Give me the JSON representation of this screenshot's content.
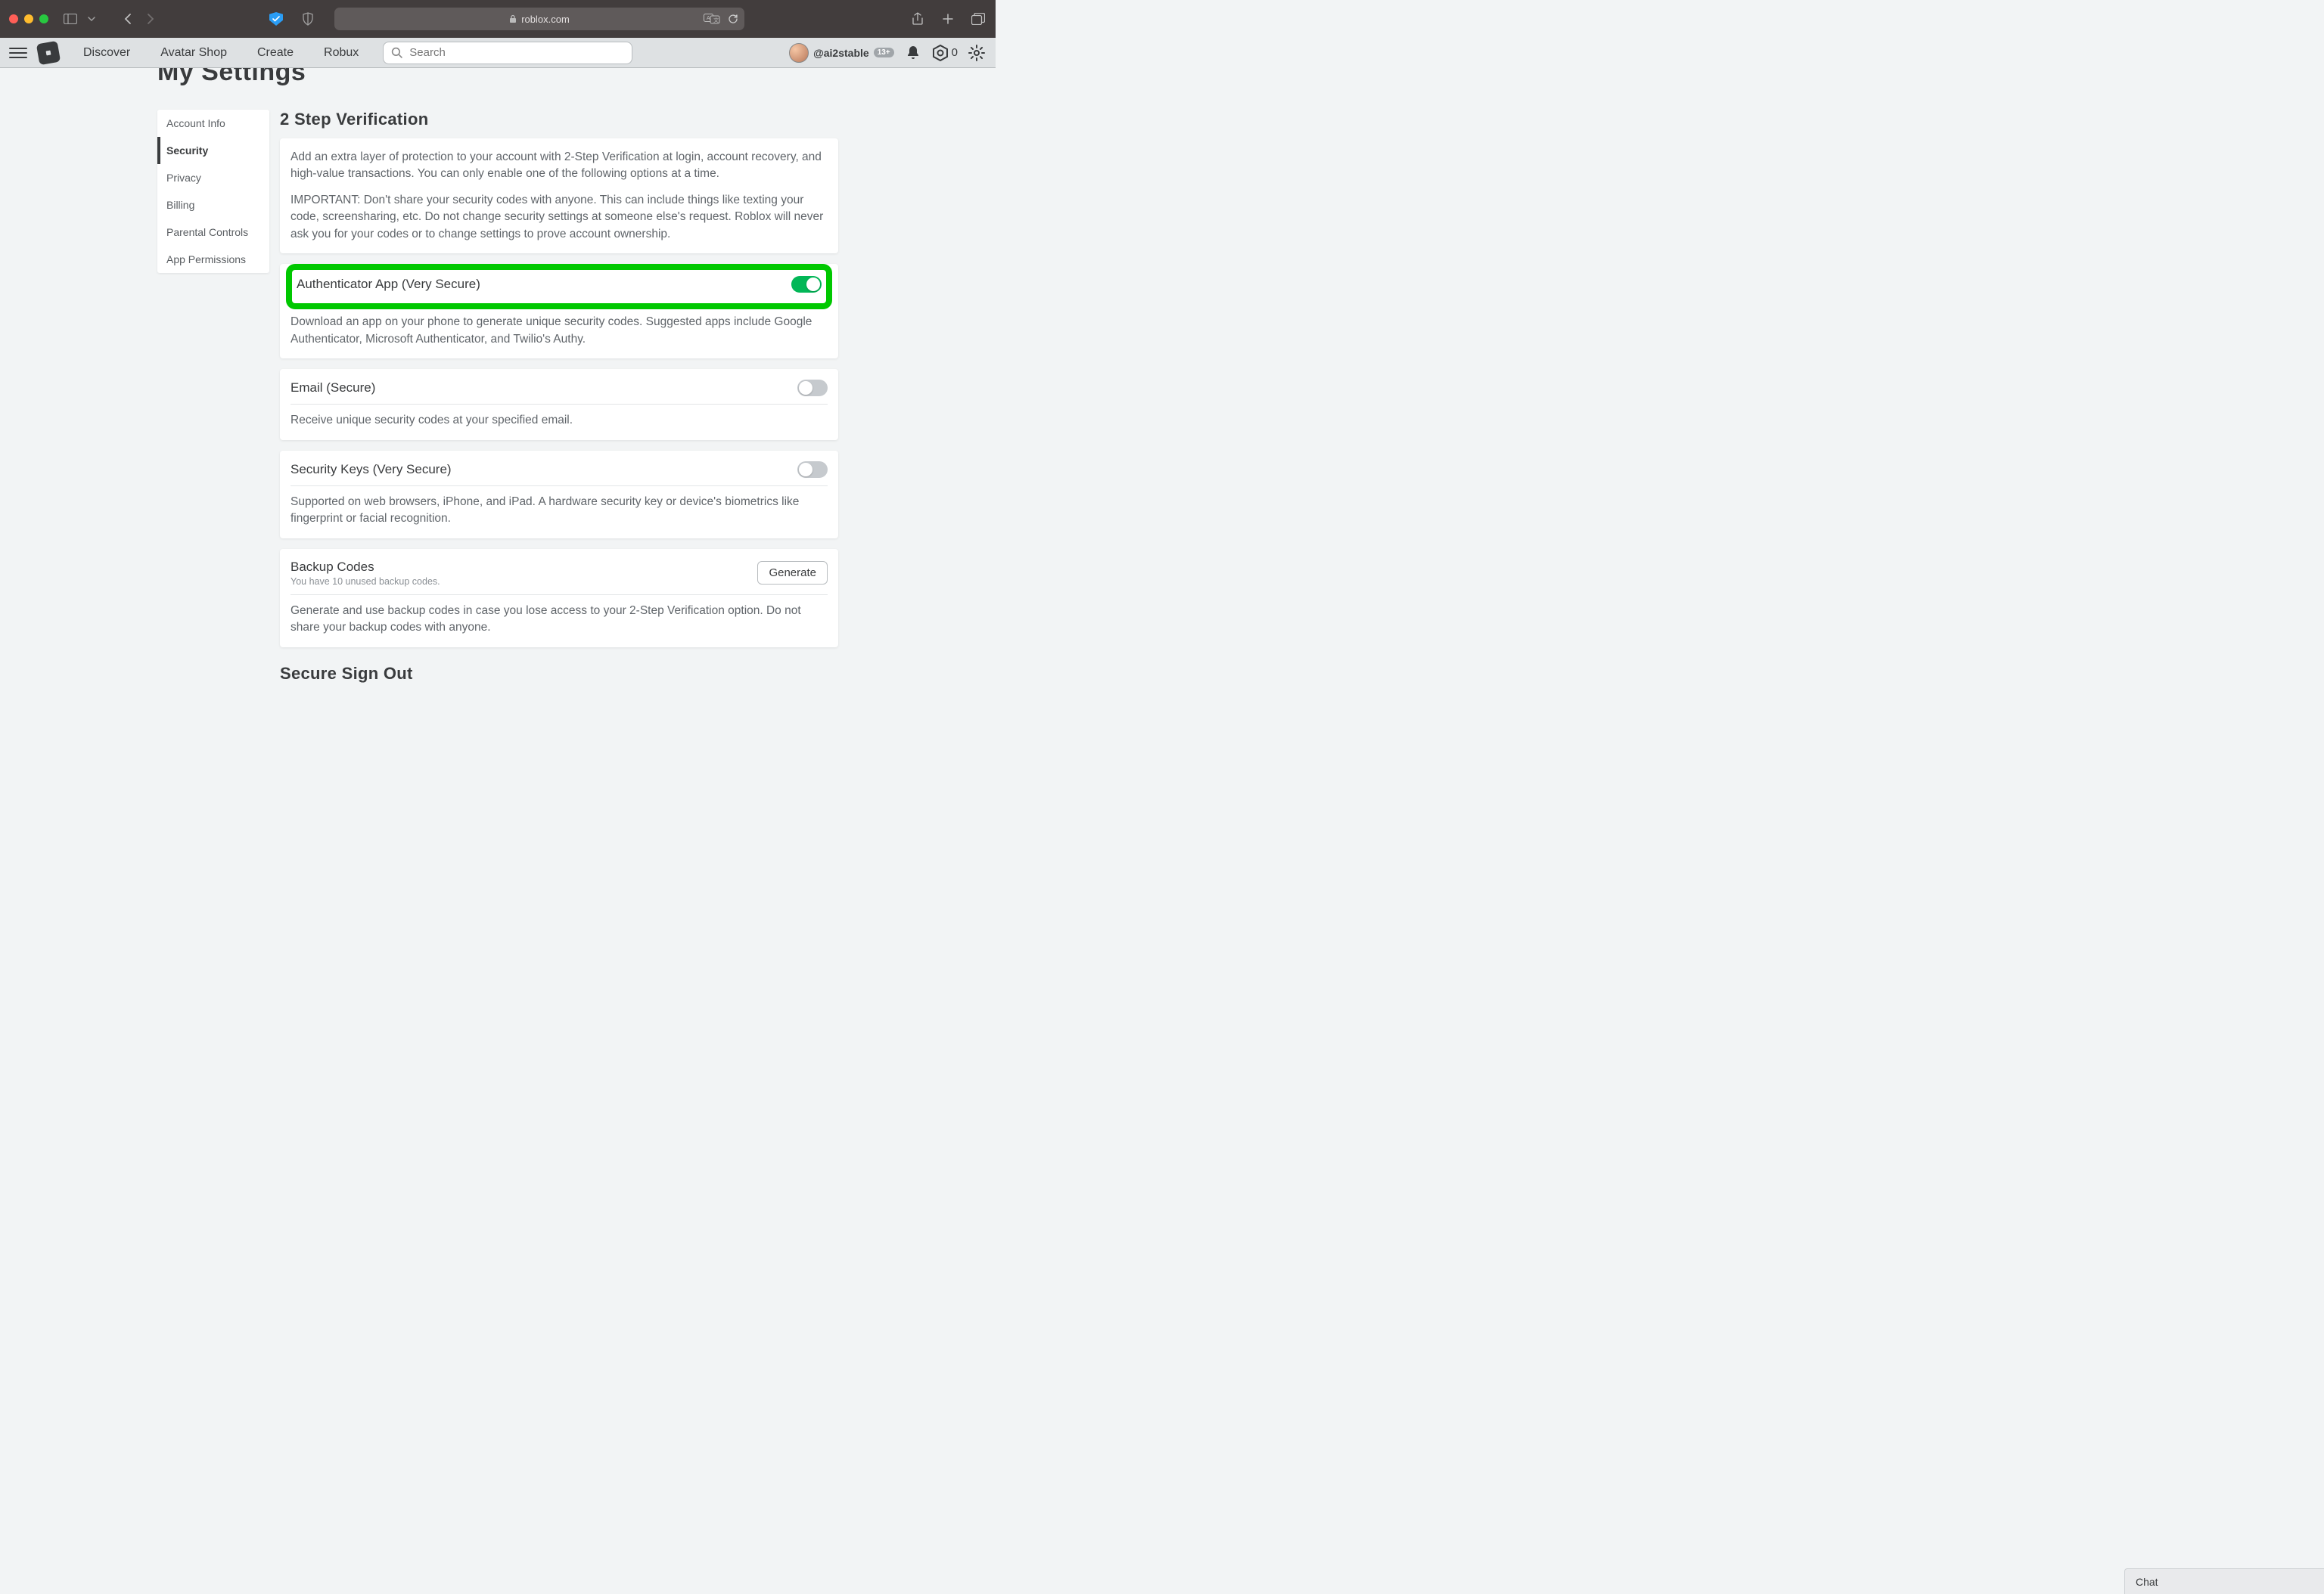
{
  "browser": {
    "url_host": "roblox.com"
  },
  "nav": {
    "links": [
      "Discover",
      "Avatar Shop",
      "Create",
      "Robux"
    ],
    "search_placeholder": "Search",
    "user_handle": "@ai2stable",
    "age_badge": "13+",
    "robux": "0"
  },
  "page": {
    "title": "My Settings"
  },
  "sidebar": {
    "items": [
      {
        "label": "Account Info"
      },
      {
        "label": "Security"
      },
      {
        "label": "Privacy"
      },
      {
        "label": "Billing"
      },
      {
        "label": "Parental Controls"
      },
      {
        "label": "App Permissions"
      }
    ],
    "active_index": 1
  },
  "section": {
    "title": "2 Step Verification",
    "intro1": "Add an extra layer of protection to your account with 2-Step Verification at login, account recovery, and high-value transactions. You can only enable one of the following options at a time.",
    "intro2": "IMPORTANT: Don't share your security codes with anyone. This can include things like texting your code, screensharing, etc. Do not change security settings at someone else's request. Roblox will never ask you for your codes or to change settings to prove account ownership."
  },
  "options": {
    "authenticator": {
      "title": "Authenticator App (Very Secure)",
      "desc": "Download an app on your phone to generate unique security codes. Suggested apps include Google Authenticator, Microsoft Authenticator, and Twilio's Authy.",
      "enabled": true
    },
    "email": {
      "title": "Email (Secure)",
      "desc": "Receive unique security codes at your specified email.",
      "enabled": false
    },
    "securitykeys": {
      "title": "Security Keys (Very Secure)",
      "desc": "Supported on web browsers, iPhone, and iPad. A hardware security key or device's biometrics like fingerprint or facial recognition.",
      "enabled": false
    },
    "backup": {
      "title": "Backup Codes",
      "sub": "You have 10 unused backup codes.",
      "desc": "Generate and use backup codes in case you lose access to your 2-Step Verification option. Do not share your backup codes with anyone.",
      "button": "Generate"
    }
  },
  "secure_signout_title": "Secure Sign Out",
  "chat_label": "Chat"
}
